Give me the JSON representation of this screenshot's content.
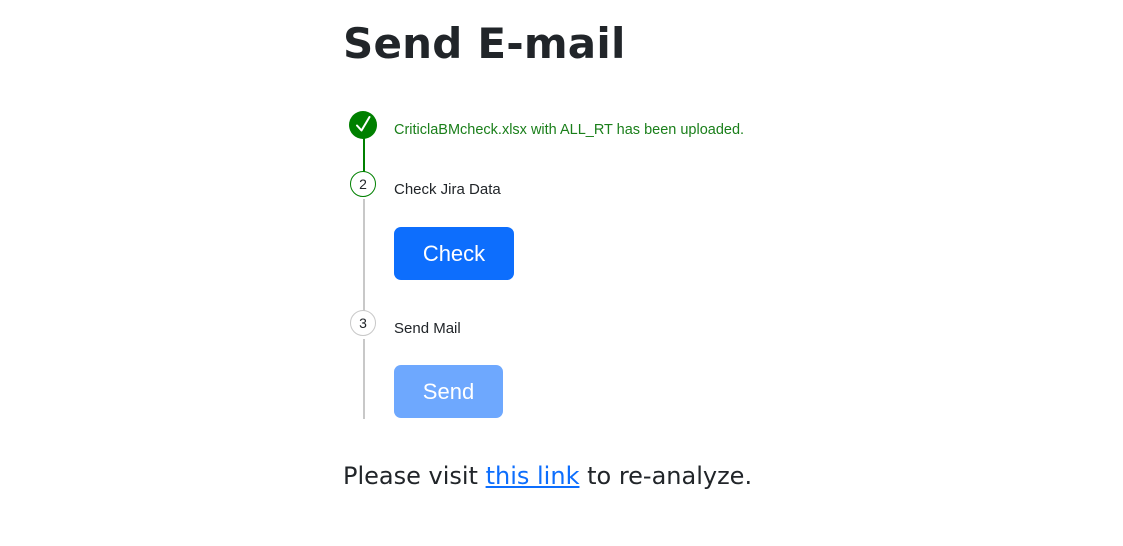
{
  "page": {
    "title": "Send E-mail"
  },
  "steps": [
    {
      "marker": "",
      "icon": "checkmark-icon",
      "text": "CriticlaBMcheck.xlsx with ALL_RT has been uploaded.",
      "status": "done"
    },
    {
      "marker": "2",
      "text": "Check Jira Data",
      "button_label": "Check",
      "status": "active"
    },
    {
      "marker": "3",
      "text": "Send Mail",
      "button_label": "Send",
      "status": "disabled"
    }
  ],
  "footer": {
    "prefix": "Please visit ",
    "link_text": "this link",
    "suffix": " to re-analyze."
  },
  "colors": {
    "done": "#008000",
    "primary": "#0d6efd",
    "disabled_primary": "#6ea8fe",
    "pending_line": "#c8c8c8"
  }
}
